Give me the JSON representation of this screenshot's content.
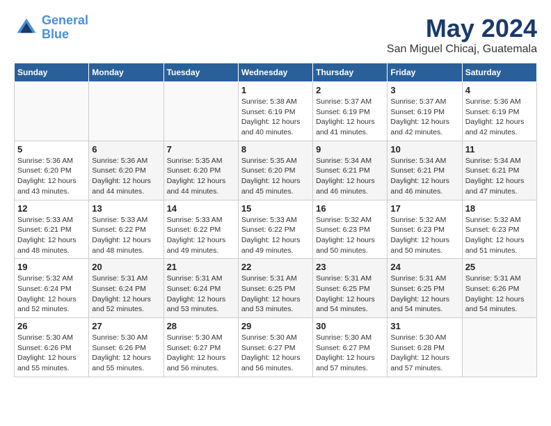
{
  "logo": {
    "line1": "General",
    "line2": "Blue"
  },
  "title": "May 2024",
  "location": "San Miguel Chicaj, Guatemala",
  "days_header": [
    "Sunday",
    "Monday",
    "Tuesday",
    "Wednesday",
    "Thursday",
    "Friday",
    "Saturday"
  ],
  "weeks": [
    [
      {
        "day": "",
        "sunrise": "",
        "sunset": "",
        "daylight": ""
      },
      {
        "day": "",
        "sunrise": "",
        "sunset": "",
        "daylight": ""
      },
      {
        "day": "",
        "sunrise": "",
        "sunset": "",
        "daylight": ""
      },
      {
        "day": "1",
        "sunrise": "Sunrise: 5:38 AM",
        "sunset": "Sunset: 6:19 PM",
        "daylight": "Daylight: 12 hours and 40 minutes."
      },
      {
        "day": "2",
        "sunrise": "Sunrise: 5:37 AM",
        "sunset": "Sunset: 6:19 PM",
        "daylight": "Daylight: 12 hours and 41 minutes."
      },
      {
        "day": "3",
        "sunrise": "Sunrise: 5:37 AM",
        "sunset": "Sunset: 6:19 PM",
        "daylight": "Daylight: 12 hours and 42 minutes."
      },
      {
        "day": "4",
        "sunrise": "Sunrise: 5:36 AM",
        "sunset": "Sunset: 6:19 PM",
        "daylight": "Daylight: 12 hours and 42 minutes."
      }
    ],
    [
      {
        "day": "5",
        "sunrise": "Sunrise: 5:36 AM",
        "sunset": "Sunset: 6:20 PM",
        "daylight": "Daylight: 12 hours and 43 minutes."
      },
      {
        "day": "6",
        "sunrise": "Sunrise: 5:36 AM",
        "sunset": "Sunset: 6:20 PM",
        "daylight": "Daylight: 12 hours and 44 minutes."
      },
      {
        "day": "7",
        "sunrise": "Sunrise: 5:35 AM",
        "sunset": "Sunset: 6:20 PM",
        "daylight": "Daylight: 12 hours and 44 minutes."
      },
      {
        "day": "8",
        "sunrise": "Sunrise: 5:35 AM",
        "sunset": "Sunset: 6:20 PM",
        "daylight": "Daylight: 12 hours and 45 minutes."
      },
      {
        "day": "9",
        "sunrise": "Sunrise: 5:34 AM",
        "sunset": "Sunset: 6:21 PM",
        "daylight": "Daylight: 12 hours and 46 minutes."
      },
      {
        "day": "10",
        "sunrise": "Sunrise: 5:34 AM",
        "sunset": "Sunset: 6:21 PM",
        "daylight": "Daylight: 12 hours and 46 minutes."
      },
      {
        "day": "11",
        "sunrise": "Sunrise: 5:34 AM",
        "sunset": "Sunset: 6:21 PM",
        "daylight": "Daylight: 12 hours and 47 minutes."
      }
    ],
    [
      {
        "day": "12",
        "sunrise": "Sunrise: 5:33 AM",
        "sunset": "Sunset: 6:21 PM",
        "daylight": "Daylight: 12 hours and 48 minutes."
      },
      {
        "day": "13",
        "sunrise": "Sunrise: 5:33 AM",
        "sunset": "Sunset: 6:22 PM",
        "daylight": "Daylight: 12 hours and 48 minutes."
      },
      {
        "day": "14",
        "sunrise": "Sunrise: 5:33 AM",
        "sunset": "Sunset: 6:22 PM",
        "daylight": "Daylight: 12 hours and 49 minutes."
      },
      {
        "day": "15",
        "sunrise": "Sunrise: 5:33 AM",
        "sunset": "Sunset: 6:22 PM",
        "daylight": "Daylight: 12 hours and 49 minutes."
      },
      {
        "day": "16",
        "sunrise": "Sunrise: 5:32 AM",
        "sunset": "Sunset: 6:23 PM",
        "daylight": "Daylight: 12 hours and 50 minutes."
      },
      {
        "day": "17",
        "sunrise": "Sunrise: 5:32 AM",
        "sunset": "Sunset: 6:23 PM",
        "daylight": "Daylight: 12 hours and 50 minutes."
      },
      {
        "day": "18",
        "sunrise": "Sunrise: 5:32 AM",
        "sunset": "Sunset: 6:23 PM",
        "daylight": "Daylight: 12 hours and 51 minutes."
      }
    ],
    [
      {
        "day": "19",
        "sunrise": "Sunrise: 5:32 AM",
        "sunset": "Sunset: 6:24 PM",
        "daylight": "Daylight: 12 hours and 52 minutes."
      },
      {
        "day": "20",
        "sunrise": "Sunrise: 5:31 AM",
        "sunset": "Sunset: 6:24 PM",
        "daylight": "Daylight: 12 hours and 52 minutes."
      },
      {
        "day": "21",
        "sunrise": "Sunrise: 5:31 AM",
        "sunset": "Sunset: 6:24 PM",
        "daylight": "Daylight: 12 hours and 53 minutes."
      },
      {
        "day": "22",
        "sunrise": "Sunrise: 5:31 AM",
        "sunset": "Sunset: 6:25 PM",
        "daylight": "Daylight: 12 hours and 53 minutes."
      },
      {
        "day": "23",
        "sunrise": "Sunrise: 5:31 AM",
        "sunset": "Sunset: 6:25 PM",
        "daylight": "Daylight: 12 hours and 54 minutes."
      },
      {
        "day": "24",
        "sunrise": "Sunrise: 5:31 AM",
        "sunset": "Sunset: 6:25 PM",
        "daylight": "Daylight: 12 hours and 54 minutes."
      },
      {
        "day": "25",
        "sunrise": "Sunrise: 5:31 AM",
        "sunset": "Sunset: 6:26 PM",
        "daylight": "Daylight: 12 hours and 54 minutes."
      }
    ],
    [
      {
        "day": "26",
        "sunrise": "Sunrise: 5:30 AM",
        "sunset": "Sunset: 6:26 PM",
        "daylight": "Daylight: 12 hours and 55 minutes."
      },
      {
        "day": "27",
        "sunrise": "Sunrise: 5:30 AM",
        "sunset": "Sunset: 6:26 PM",
        "daylight": "Daylight: 12 hours and 55 minutes."
      },
      {
        "day": "28",
        "sunrise": "Sunrise: 5:30 AM",
        "sunset": "Sunset: 6:27 PM",
        "daylight": "Daylight: 12 hours and 56 minutes."
      },
      {
        "day": "29",
        "sunrise": "Sunrise: 5:30 AM",
        "sunset": "Sunset: 6:27 PM",
        "daylight": "Daylight: 12 hours and 56 minutes."
      },
      {
        "day": "30",
        "sunrise": "Sunrise: 5:30 AM",
        "sunset": "Sunset: 6:27 PM",
        "daylight": "Daylight: 12 hours and 57 minutes."
      },
      {
        "day": "31",
        "sunrise": "Sunrise: 5:30 AM",
        "sunset": "Sunset: 6:28 PM",
        "daylight": "Daylight: 12 hours and 57 minutes."
      },
      {
        "day": "",
        "sunrise": "",
        "sunset": "",
        "daylight": ""
      }
    ]
  ]
}
